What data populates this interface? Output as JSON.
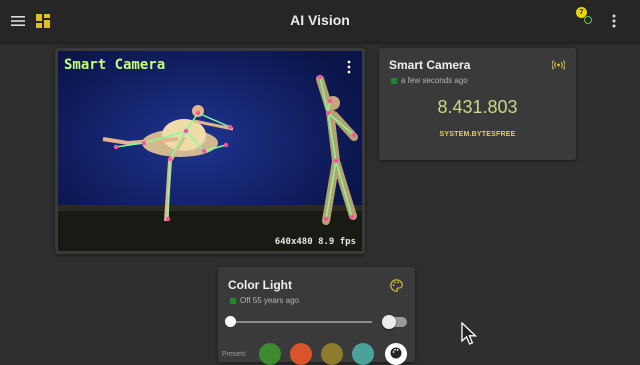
{
  "header": {
    "title": "AI Vision",
    "notification_count": "7",
    "icons": [
      "menu-icon",
      "dashboard-icon",
      "connection-status-icon",
      "more-vert-icon"
    ]
  },
  "camera": {
    "title": "Smart Camera",
    "fps_text": "640x480 8.9 fps",
    "menu_icon": "more-vert-icon"
  },
  "stat": {
    "title": "Smart Camera",
    "timestamp": "a few seconds ago",
    "value": "8.431.803",
    "label": "SYSTEM.BYTESFREE",
    "icon": "broadcast-icon"
  },
  "light": {
    "title": "Color Light",
    "status": "Off 55 years ago",
    "brightness": 0,
    "power_on": false,
    "presets_label": "Presets",
    "icon": "palette-icon",
    "preset_colors": [
      "#3d8a30",
      "#d9532b",
      "#8c7b2c",
      "#4aa29b",
      "#ffffff"
    ]
  },
  "colors": {
    "accent_green": "#c6ff7f",
    "value_color": "#c8d98a",
    "label_yellow": "#e8d24a",
    "status_green": "#1c8a2e"
  }
}
